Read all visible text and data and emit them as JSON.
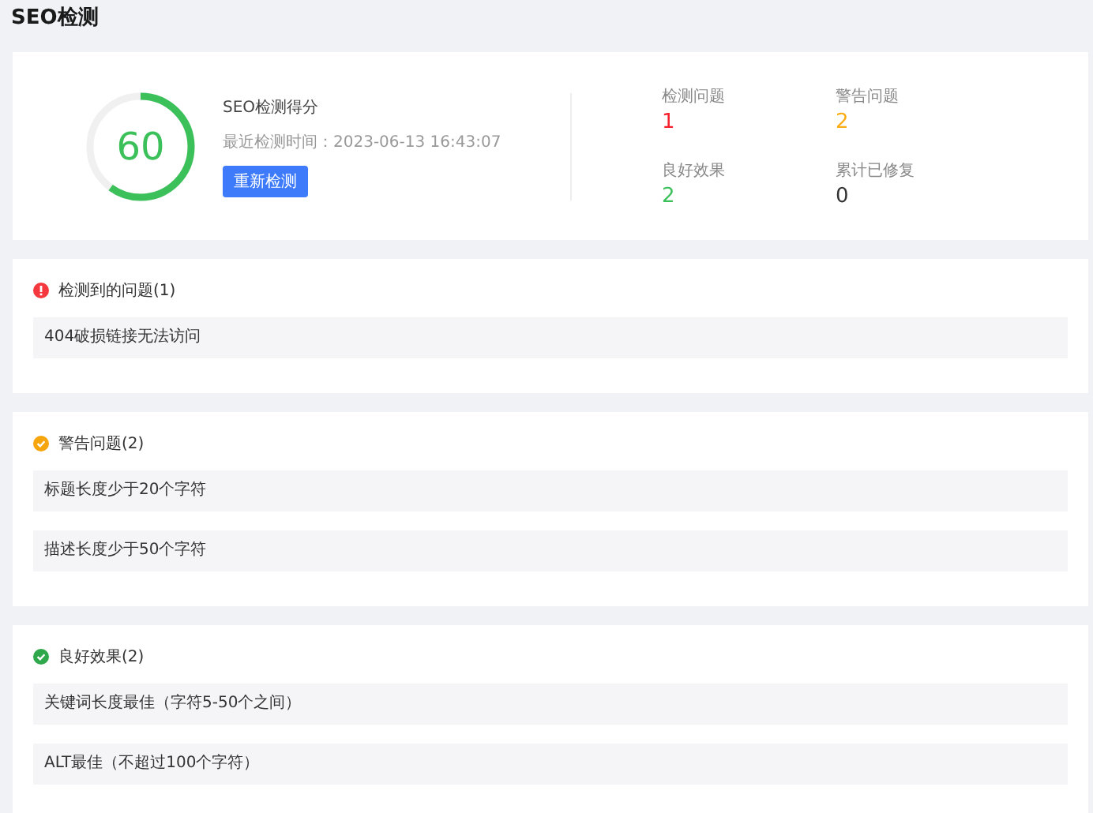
{
  "page_title": "SEO检测",
  "score": {
    "value": "60",
    "level": 0.6,
    "label": "SEO检测得分",
    "last_check": "最近检测时间：2023-06-13 16:43:07",
    "button": "重新检测"
  },
  "stats": [
    {
      "label": "检测问题",
      "value": "1",
      "kind": "error"
    },
    {
      "label": "警告问题",
      "value": "2",
      "kind": "warning"
    },
    {
      "label": "良好效果",
      "value": "2",
      "kind": "success"
    },
    {
      "label": "累计已修复",
      "value": "0",
      "kind": "neutral"
    }
  ],
  "sections": [
    {
      "title": "检测到的问题(1)",
      "kind": "error",
      "items": [
        "404破损链接无法访问"
      ]
    },
    {
      "title": "警告问题(2)",
      "kind": "warning",
      "items": [
        "标题长度少于20个字符",
        "描述长度少于50个字符"
      ]
    },
    {
      "title": "良好效果(2)",
      "kind": "success",
      "items": [
        "关键词长度最佳（字符5-50个之间）",
        "ALT最佳（不超过100个字符）"
      ]
    }
  ]
}
